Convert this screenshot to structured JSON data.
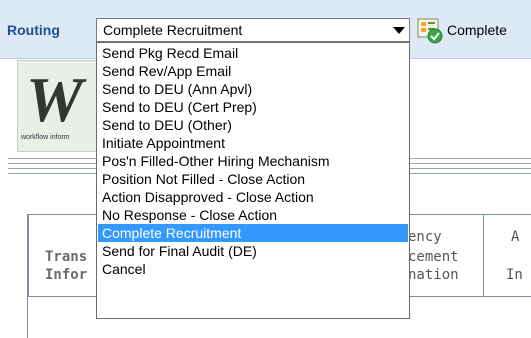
{
  "routing": {
    "label": "Routing",
    "selected_value": "Complete Recruitment",
    "action_label": "Complete"
  },
  "logo": {
    "mark": "W",
    "caption": "workflow inform"
  },
  "table": {
    "col1_line1": "Trans",
    "col1_line2": "Infor",
    "col2_line1": "ency",
    "col2_line2": "cement",
    "col2_line3": "nation",
    "col3_line1": "A",
    "col3_line2": "In"
  },
  "dropdown": {
    "options": [
      "Send Pkg Recd Email",
      "Send Rev/App Email",
      "Send to DEU (Ann Apvl)",
      "Send to DEU (Cert Prep)",
      "Send to DEU (Other)",
      "Initiate Appointment",
      "Pos'n Filled-Other Hiring Mechanism",
      "Position Not Filled - Close Action",
      "Action Disapproved - Close Action",
      "No Response - Close Action",
      "Complete Recruitment",
      "Send for Final Audit (DE)",
      "Cancel"
    ],
    "selected_index": 10
  },
  "colors": {
    "selection": "#3399ff",
    "routing_label": "#1f4f8f",
    "topbar": "#dde9f7"
  }
}
